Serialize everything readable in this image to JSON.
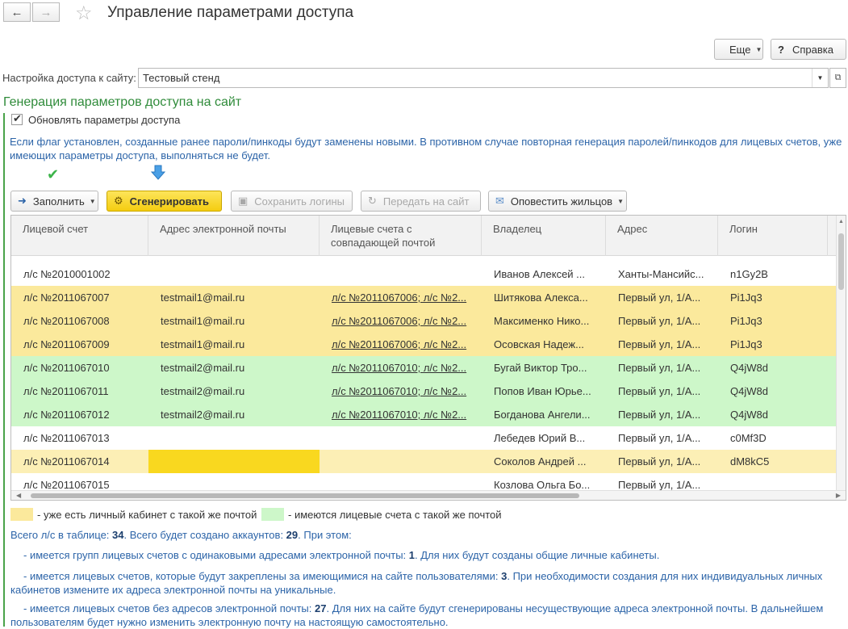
{
  "header": {
    "title": "Управление параметрами доступа",
    "more_label": "Еще",
    "help_label": "Справка"
  },
  "site_setting": {
    "label": "Настройка доступа к сайту:",
    "value": "Тестовый стенд"
  },
  "generation": {
    "title": "Генерация параметров доступа на сайт",
    "checkbox_label": "Обновлять параметры доступа",
    "info": "Если флаг установлен, созданные ранее пароли/пинкоды будут заменены новыми. В противном случае повторная генерация паролей/пинкодов для лицевых счетов, уже имеющих параметры доступа, выполняться не будет."
  },
  "toolbar": {
    "fill_label": "Заполнить",
    "generate_label": "Сгенерировать",
    "save_logins_label": "Сохранить логины",
    "send_label": "Передать на сайт",
    "notify_label": "Оповестить жильцов"
  },
  "table": {
    "columns": [
      "Лицевой счет",
      "Адрес электронной почты",
      "Лицевые счета с совпадающей почтой",
      "Владелец",
      "Адрес",
      "Логин"
    ],
    "rows": [
      {
        "account": "л/с №2010001002",
        "email": "",
        "matches": "",
        "owner": "Иванов Алексей ...",
        "address": "Ханты-Мансийс...",
        "login": "n1Gy2B",
        "bg": "#ffffff"
      },
      {
        "account": "л/с №2011067007",
        "email": "testmail1@mail.ru",
        "matches": "л/с №2011067006; л/с №2...",
        "owner": "Шитякова Алекса...",
        "address": "Первый ул, 1/А...",
        "login": "Pi1Jq3",
        "bg": "#fbe99c"
      },
      {
        "account": "л/с №2011067008",
        "email": "testmail1@mail.ru",
        "matches": "л/с №2011067006; л/с №2...",
        "owner": "Максименко Нико...",
        "address": "Первый ул, 1/А...",
        "login": "Pi1Jq3",
        "bg": "#fbe99c"
      },
      {
        "account": "л/с №2011067009",
        "email": "testmail1@mail.ru",
        "matches": "л/с №2011067006; л/с №2...",
        "owner": "Осовская Надеж...",
        "address": "Первый ул, 1/А...",
        "login": "Pi1Jq3",
        "bg": "#fbe99c"
      },
      {
        "account": "л/с №2011067010",
        "email": "testmail2@mail.ru",
        "matches": "л/с №2011067010; л/с №2...",
        "owner": "Бугай Виктор Тро...",
        "address": "Первый ул, 1/А...",
        "login": "Q4jW8d",
        "bg": "#cdf7c9"
      },
      {
        "account": "л/с №2011067011",
        "email": "testmail2@mail.ru",
        "matches": "л/с №2011067010; л/с №2...",
        "owner": "Попов Иван Юрье...",
        "address": "Первый ул, 1/А...",
        "login": "Q4jW8d",
        "bg": "#cdf7c9"
      },
      {
        "account": "л/с №2011067012",
        "email": "testmail2@mail.ru",
        "matches": "л/с №2011067010; л/с №2...",
        "owner": "Богданова Ангели...",
        "address": "Первый ул, 1/А...",
        "login": "Q4jW8d",
        "bg": "#cdf7c9"
      },
      {
        "account": "л/с №2011067013",
        "email": "",
        "matches": "",
        "owner": "Лебедев Юрий В...",
        "address": "Первый ул, 1/А...",
        "login": "c0Mf3D",
        "bg": "#ffffff"
      },
      {
        "account": "л/с №2011067014",
        "email": "",
        "matches": "",
        "owner": "Соколов Андрей ...",
        "address": "Первый ул, 1/А...",
        "login": "dM8kC5",
        "bg": "#fcefb5"
      },
      {
        "account": "л/с №2011067015",
        "email": "",
        "matches": "",
        "owner": "Козлова Ольга Бо...",
        "address": "Первый ул, 1/А...",
        "login": "",
        "bg": "#ffffff"
      }
    ]
  },
  "legend": {
    "yellow_label": "- уже есть личный кабинет с такой же почтой",
    "green_label": "- имеются лицевые счета с такой же почтой",
    "yellow_color": "#fbe99c",
    "green_color": "#cdf7c9"
  },
  "summary": {
    "line1_a": "Всего л/с в таблице: ",
    "total": "34",
    "line1_b": ". Всего будет создано аккаунтов: ",
    "accounts": "29",
    "line1_c": ". При этом:",
    "line2_a": "- имеется групп лицевых счетов с одинаковыми адресами электронной почты: ",
    "groups": "1",
    "line2_b": ". Для них будут созданы общие личные кабинеты.",
    "line3_a": "- имеется лицевых счетов, которые будут закреплены за имеющимися на сайте пользователями: ",
    "attached": "3",
    "line3_b": ". При необходимости создания для них индивидуальных личных кабинетов измените их адреса электронной почты на уникальные.",
    "line4_a": "- имеется лицевых счетов без адресов электронной почты: ",
    "no_email": "27",
    "line4_b": ". Для них на сайте будут сгенерированы несуществующие адреса электронной почты. В дальнейшем пользователям будет нужно изменить электронную почту на настоящую самостоятельно."
  }
}
